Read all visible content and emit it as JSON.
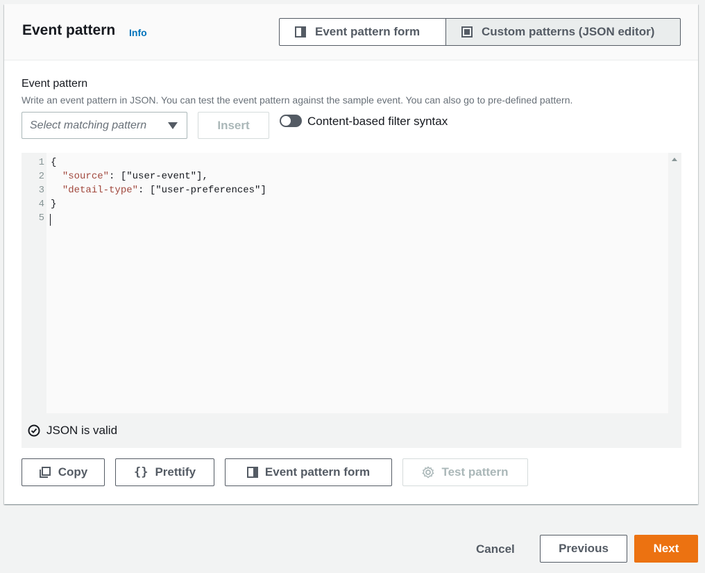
{
  "header": {
    "title": "Event pattern",
    "info_label": "Info",
    "segments": [
      {
        "label": "Event pattern form",
        "icon": "split-panel-icon",
        "selected": false
      },
      {
        "label": "Custom patterns (JSON editor)",
        "icon": "filled-square-icon",
        "selected": true
      }
    ]
  },
  "section": {
    "label": "Event pattern",
    "description": "Write an event pattern in JSON. You can test the event pattern against the sample event. You can also go to pre-defined pattern.",
    "select_placeholder": "Select matching pattern",
    "insert_label": "Insert",
    "toggle_label": "Content-based filter syntax",
    "toggle_on": false
  },
  "editor": {
    "lines": [
      {
        "num": "1",
        "text": "{"
      },
      {
        "num": "2",
        "key": "\"source\"",
        "rest": ": [\"user-event\"],"
      },
      {
        "num": "3",
        "key": "\"detail-type\"",
        "rest": ": [\"user-preferences\"]"
      },
      {
        "num": "4",
        "text": "}"
      },
      {
        "num": "5",
        "text": ""
      }
    ],
    "status": "JSON is valid"
  },
  "actions": {
    "copy": "Copy",
    "prettify": "Prettify",
    "event_pattern_form": "Event pattern form",
    "test_pattern": "Test pattern"
  },
  "footer": {
    "cancel": "Cancel",
    "previous": "Previous",
    "next": "Next"
  },
  "colors": {
    "accent": "#ec7211",
    "link": "#0073bb",
    "json_key": "#a1483d"
  }
}
